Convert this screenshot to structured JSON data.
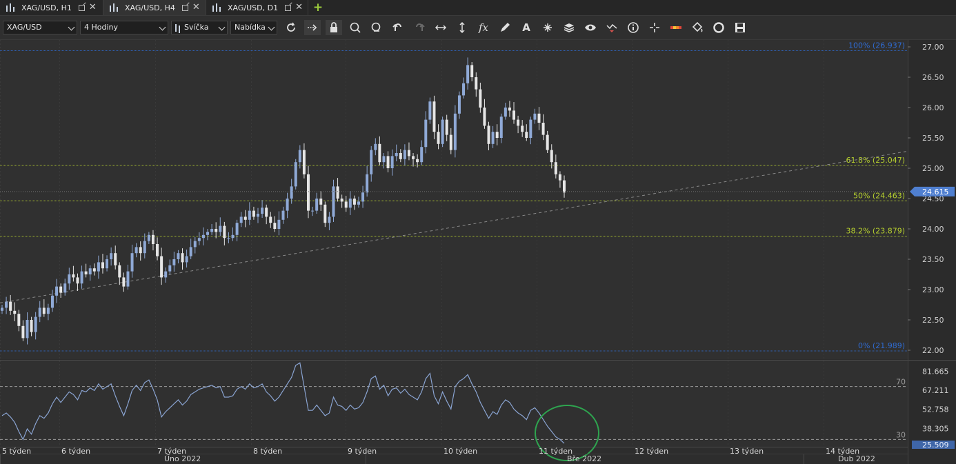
{
  "tabs": [
    {
      "label": "XAG/USD, H1",
      "active": false
    },
    {
      "label": "XAG/USD, H4",
      "active": true
    },
    {
      "label": "XAG/USD, D1",
      "active": false
    }
  ],
  "toolbar": {
    "symbol": "XAG/USD",
    "timeframe": "4 Hodiny",
    "chart_type": "Svíčka",
    "menu": "Nabídka",
    "icons": [
      "refresh-icon",
      "autoscroll-icon",
      "lock-icon",
      "zoom-in-icon",
      "zoom-out-icon",
      "undo-icon",
      "redo-icon",
      "horizontal-scale-icon",
      "vertical-scale-icon",
      "indicator-fx-icon",
      "pencil-icon",
      "text-icon",
      "objects-icon",
      "layers-icon",
      "eye-icon",
      "signals-icon",
      "info-icon",
      "crosshair-icon",
      "theme-icon",
      "paint-icon",
      "template-icon",
      "save-icon"
    ]
  },
  "colors": {
    "bull": "#8fa9d6",
    "bear": "#e6e6e6",
    "fib_top": "#2f6bd1",
    "fib_mid": "#b7d02f",
    "price_box": "#4f7fd0",
    "rsi": "#8aa4d2",
    "circle": "#2ea44f"
  },
  "chart_data": {
    "type": "candlestick",
    "symbol": "XAG/USD",
    "y_ticks": [
      "27.00",
      "26.50",
      "26.00",
      "25.50",
      "25.00",
      "24.50",
      "24.00",
      "23.50",
      "23.00",
      "22.50",
      "22.00"
    ],
    "ylim": [
      21.95,
      27.05
    ],
    "current_price": "24.615",
    "fib_levels": [
      {
        "label": "100% (26.937)",
        "value": 26.937
      },
      {
        "label": "61.8% (25.047)",
        "value": 25.047
      },
      {
        "label": "50% (24.463)",
        "value": 24.463
      },
      {
        "label": "38.2% (23.879)",
        "value": 23.879
      },
      {
        "label": "0% (21.989)",
        "value": 21.989
      }
    ],
    "trendline": {
      "start": 22.78,
      "end": 25.28
    },
    "closes": [
      22.7,
      22.8,
      22.65,
      22.6,
      22.4,
      22.2,
      22.5,
      22.3,
      22.55,
      22.7,
      22.6,
      22.7,
      22.9,
      23.05,
      22.95,
      23.1,
      23.25,
      23.2,
      23.1,
      23.3,
      23.25,
      23.35,
      23.3,
      23.45,
      23.35,
      23.5,
      23.6,
      23.4,
      23.2,
      23.05,
      23.3,
      23.6,
      23.7,
      23.6,
      23.8,
      23.9,
      23.75,
      23.55,
      23.2,
      23.3,
      23.4,
      23.5,
      23.6,
      23.45,
      23.55,
      23.7,
      23.8,
      23.85,
      23.9,
      23.95,
      24.0,
      23.95,
      24.05,
      23.85,
      23.85,
      23.9,
      24.1,
      24.2,
      24.15,
      24.3,
      24.2,
      24.25,
      24.35,
      24.2,
      24.1,
      24.0,
      24.15,
      24.3,
      24.5,
      24.7,
      25.1,
      25.3,
      24.9,
      24.3,
      24.3,
      24.5,
      24.4,
      24.1,
      24.2,
      24.7,
      24.5,
      24.45,
      24.35,
      24.5,
      24.4,
      24.45,
      24.6,
      24.9,
      25.3,
      25.4,
      25.1,
      25.2,
      25.0,
      25.2,
      25.25,
      25.15,
      25.3,
      25.2,
      25.15,
      25.1,
      25.35,
      25.8,
      26.1,
      25.6,
      25.4,
      25.8,
      25.55,
      25.3,
      25.9,
      26.2,
      26.4,
      26.7,
      26.5,
      26.3,
      26.0,
      25.7,
      25.4,
      25.6,
      25.5,
      25.85,
      26.0,
      25.95,
      25.8,
      25.7,
      25.6,
      25.5,
      25.8,
      25.9,
      25.75,
      25.55,
      25.3,
      25.1,
      24.9,
      24.8,
      24.6
    ],
    "rsi": {
      "ticks": [
        "81.665",
        "67.211",
        "52.758",
        "38.305",
        "25.509"
      ],
      "ylim": [
        25.509,
        86.0
      ],
      "levels": [
        {
          "label": "70",
          "value": 70
        },
        {
          "label": "30",
          "value": 30
        }
      ],
      "values": [
        48,
        50,
        47,
        43,
        36,
        30,
        38,
        34,
        42,
        48,
        46,
        50,
        57,
        62,
        58,
        62,
        66,
        64,
        60,
        67,
        66,
        69,
        67,
        72,
        68,
        70,
        72,
        63,
        55,
        48,
        57,
        67,
        71,
        67,
        73,
        75,
        68,
        60,
        47,
        51,
        54,
        57,
        60,
        56,
        59,
        64,
        66,
        68,
        69,
        70,
        71,
        69,
        70,
        62,
        62,
        63,
        68,
        70,
        68,
        72,
        69,
        70,
        72,
        66,
        63,
        59,
        62,
        67,
        72,
        77,
        86,
        88,
        70,
        52,
        52,
        56,
        52,
        48,
        50,
        62,
        56,
        55,
        52,
        56,
        53,
        54,
        58,
        66,
        76,
        78,
        68,
        71,
        63,
        68,
        69,
        65,
        68,
        64,
        62,
        60,
        66,
        76,
        80,
        63,
        57,
        66,
        59,
        53,
        70,
        74,
        76,
        79,
        72,
        66,
        58,
        52,
        46,
        51,
        49,
        56,
        60,
        58,
        53,
        50,
        48,
        45,
        52,
        54,
        50,
        45,
        40,
        36,
        32,
        30,
        27
      ]
    },
    "x_labels": [
      "5 týden",
      "6 týden",
      "7 týden",
      "8 týden",
      "9 týden",
      "10 týden",
      "11 týden",
      "12 týden",
      "13 týden",
      "14 týden"
    ],
    "month_labels": [
      "Úno 2022",
      "Bře 2022",
      "Dub 2022"
    ]
  }
}
